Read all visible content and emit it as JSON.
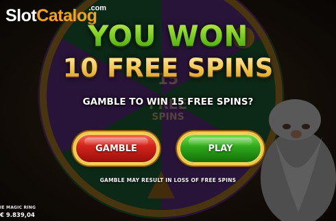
{
  "watermark": {
    "brand_part1": "Slot",
    "brand_part2": "Catalog",
    "brand_suffix": ".com"
  },
  "popup": {
    "headline": "YOU WON",
    "award": "10 FREE SPINS",
    "prompt": "GAMBLE TO WIN 15 FREE SPINS?",
    "gamble_label": "GAMBLE",
    "play_label": "PLAY",
    "warning": "GAMBLE MAY RESULT IN LOSS OF FREE SPINS"
  },
  "background_wheel": {
    "center_number": "15",
    "center_text_1": "FREE",
    "center_text_2": "SPINS"
  },
  "footer": {
    "game_name": "IE MAGIC RING",
    "balance": "€ 9.839,04"
  },
  "colors": {
    "headline_green": "#7fd321",
    "award_gold": "#f4c650",
    "gamble_red": "#d3241c",
    "play_green": "#2ea61a",
    "button_rim": "#f3c84a",
    "logo_orange": "#f3a21a"
  }
}
